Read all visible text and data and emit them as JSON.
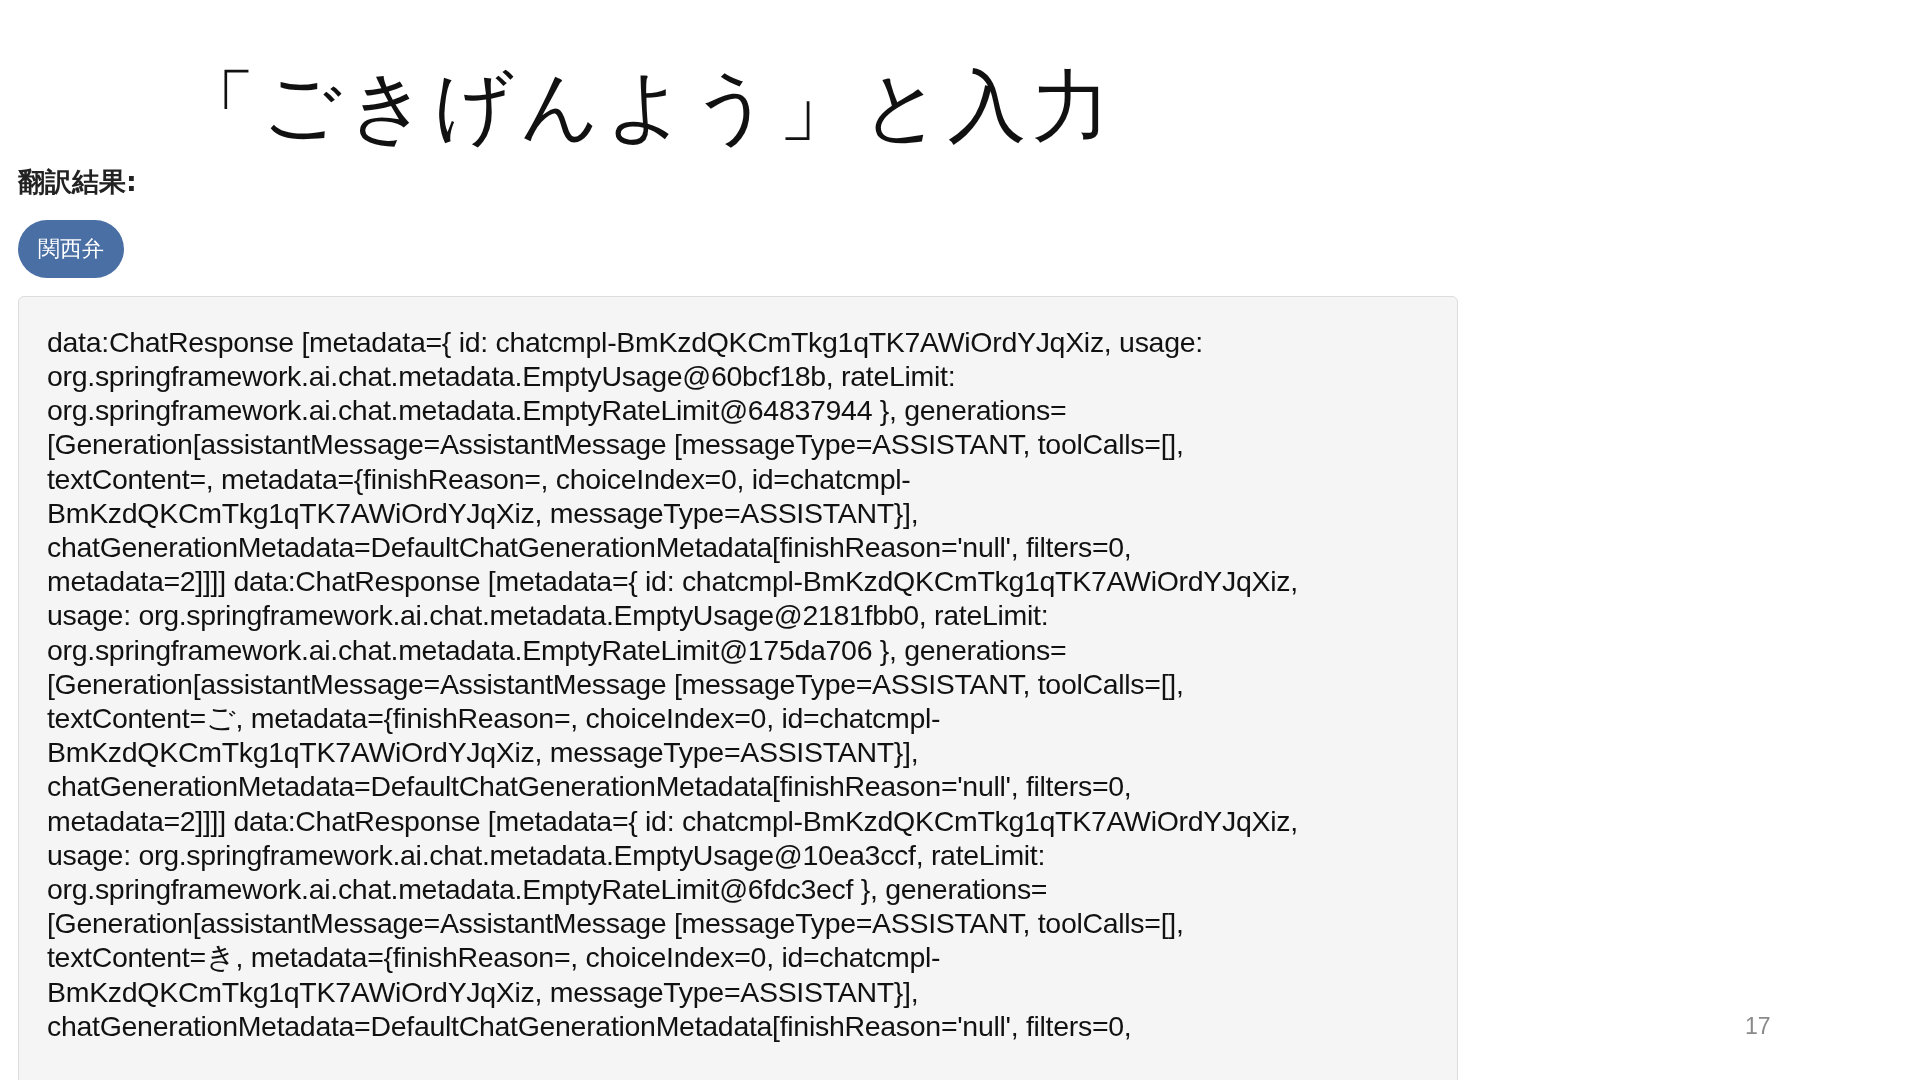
{
  "slide_title": "「ごきげんよう」と入力",
  "result_label": "翻訳結果:",
  "dialect_badge": "関西弁",
  "response_lines": [
    "data:ChatResponse [metadata={ id: chatcmpl-BmKzdQKCmTkg1qTK7AWiOrdYJqXiz, usage:",
    "org.springframework.ai.chat.metadata.EmptyUsage@60bcf18b, rateLimit:",
    "org.springframework.ai.chat.metadata.EmptyRateLimit@64837944 }, generations=",
    "[Generation[assistantMessage=AssistantMessage [messageType=ASSISTANT, toolCalls=[],",
    "textContent=, metadata={finishReason=, choiceIndex=0, id=chatcmpl-",
    "BmKzdQKCmTkg1qTK7AWiOrdYJqXiz, messageType=ASSISTANT}],",
    "chatGenerationMetadata=DefaultChatGenerationMetadata[finishReason='null', filters=0,",
    "metadata=2]]]] data:ChatResponse [metadata={ id: chatcmpl-BmKzdQKCmTkg1qTK7AWiOrdYJqXiz,",
    "usage: org.springframework.ai.chat.metadata.EmptyUsage@2181fbb0, rateLimit:",
    "org.springframework.ai.chat.metadata.EmptyRateLimit@175da706 }, generations=",
    "[Generation[assistantMessage=AssistantMessage [messageType=ASSISTANT, toolCalls=[],",
    "textContent=ご, metadata={finishReason=, choiceIndex=0, id=chatcmpl-",
    "BmKzdQKCmTkg1qTK7AWiOrdYJqXiz, messageType=ASSISTANT}],",
    "chatGenerationMetadata=DefaultChatGenerationMetadata[finishReason='null', filters=0,",
    "metadata=2]]]] data:ChatResponse [metadata={ id: chatcmpl-BmKzdQKCmTkg1qTK7AWiOrdYJqXiz,",
    "usage: org.springframework.ai.chat.metadata.EmptyUsage@10ea3ccf, rateLimit:",
    "org.springframework.ai.chat.metadata.EmptyRateLimit@6fdc3ecf }, generations=",
    "[Generation[assistantMessage=AssistantMessage [messageType=ASSISTANT, toolCalls=[],",
    "textContent=き, metadata={finishReason=, choiceIndex=0, id=chatcmpl-",
    "BmKzdQKCmTkg1qTK7AWiOrdYJqXiz, messageType=ASSISTANT}],",
    "chatGenerationMetadata=DefaultChatGenerationMetadata[finishReason='null', filters=0,"
  ],
  "page_number": "17"
}
